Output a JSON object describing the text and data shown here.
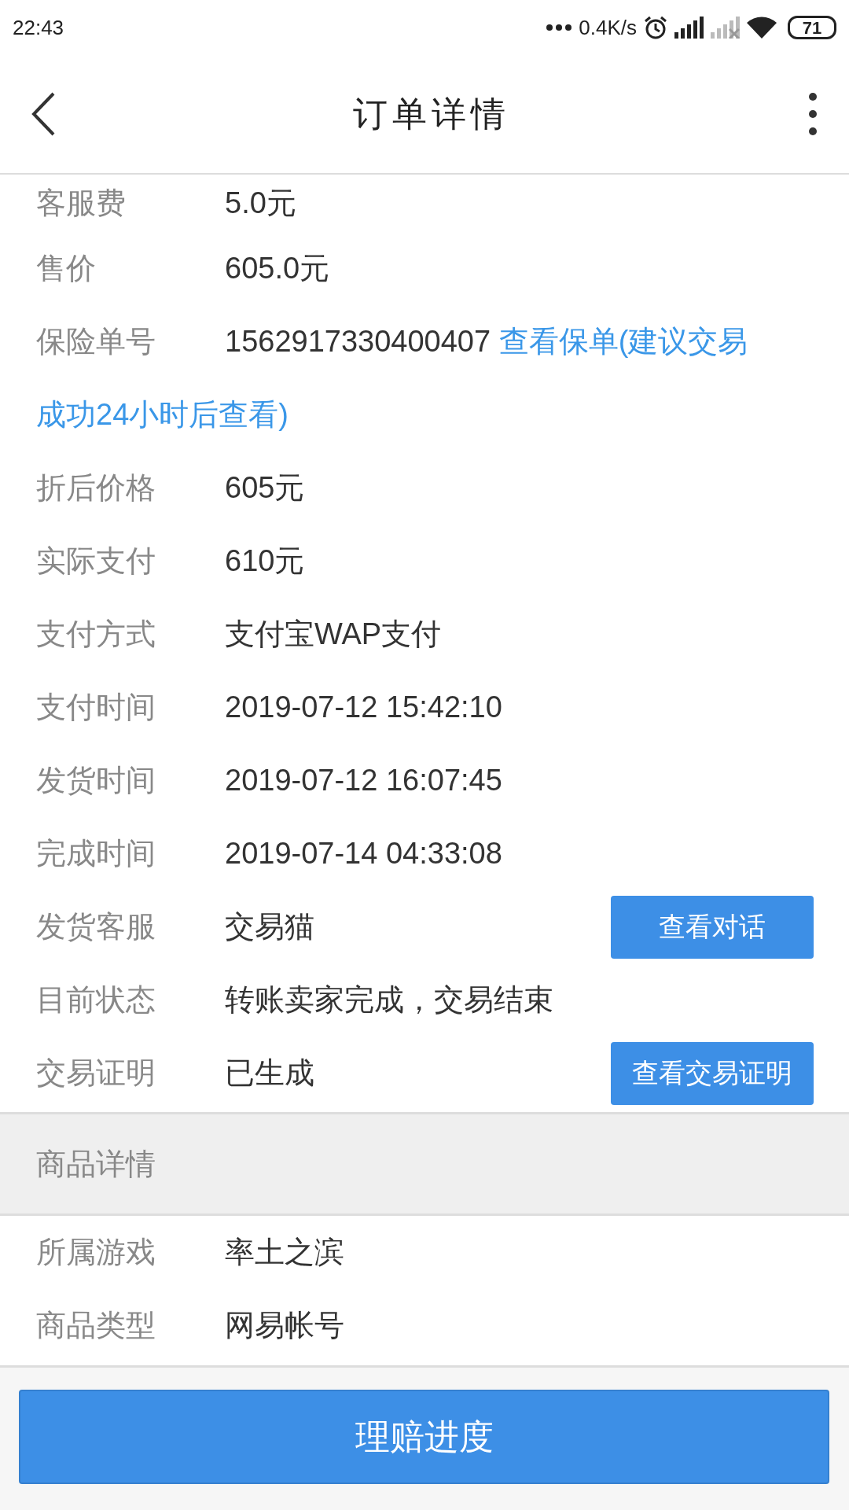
{
  "status_bar": {
    "time": "22:43",
    "net_speed": "0.4K/s",
    "battery": "71"
  },
  "header": {
    "title": "订单详情"
  },
  "order_rows": [
    {
      "kind": "plain",
      "label": "客服费",
      "value": "5.0元"
    },
    {
      "kind": "plain",
      "label": "售价",
      "value": "605.0元"
    },
    {
      "kind": "link",
      "label": "保险单号",
      "value": "1562917330400407",
      "link_lines": [
        "查看保单(建议交易",
        "成功24小时后查看)"
      ]
    },
    {
      "kind": "plain",
      "label": "折后价格",
      "value": "605元"
    },
    {
      "kind": "plain",
      "label": "实际支付",
      "value": "610元"
    },
    {
      "kind": "plain",
      "label": "支付方式",
      "value": "支付宝WAP支付"
    },
    {
      "kind": "plain",
      "label": "支付时间",
      "value": "2019-07-12 15:42:10"
    },
    {
      "kind": "plain",
      "label": "发货时间",
      "value": "2019-07-12 16:07:45"
    },
    {
      "kind": "plain",
      "label": "完成时间",
      "value": "2019-07-14 04:33:08"
    },
    {
      "kind": "button",
      "label": "发货客服",
      "value": "交易猫",
      "button": "查看对话"
    },
    {
      "kind": "plain",
      "label": "目前状态",
      "value": "转账卖家完成，交易结束"
    },
    {
      "kind": "button",
      "label": "交易证明",
      "value": "已生成",
      "button": "查看交易证明"
    }
  ],
  "section_title": "商品详情",
  "goods_rows": [
    {
      "label": "所属游戏",
      "value": "率土之滨"
    },
    {
      "label": "商品类型",
      "value": "网易帐号"
    }
  ],
  "footer_button": "理赔进度"
}
